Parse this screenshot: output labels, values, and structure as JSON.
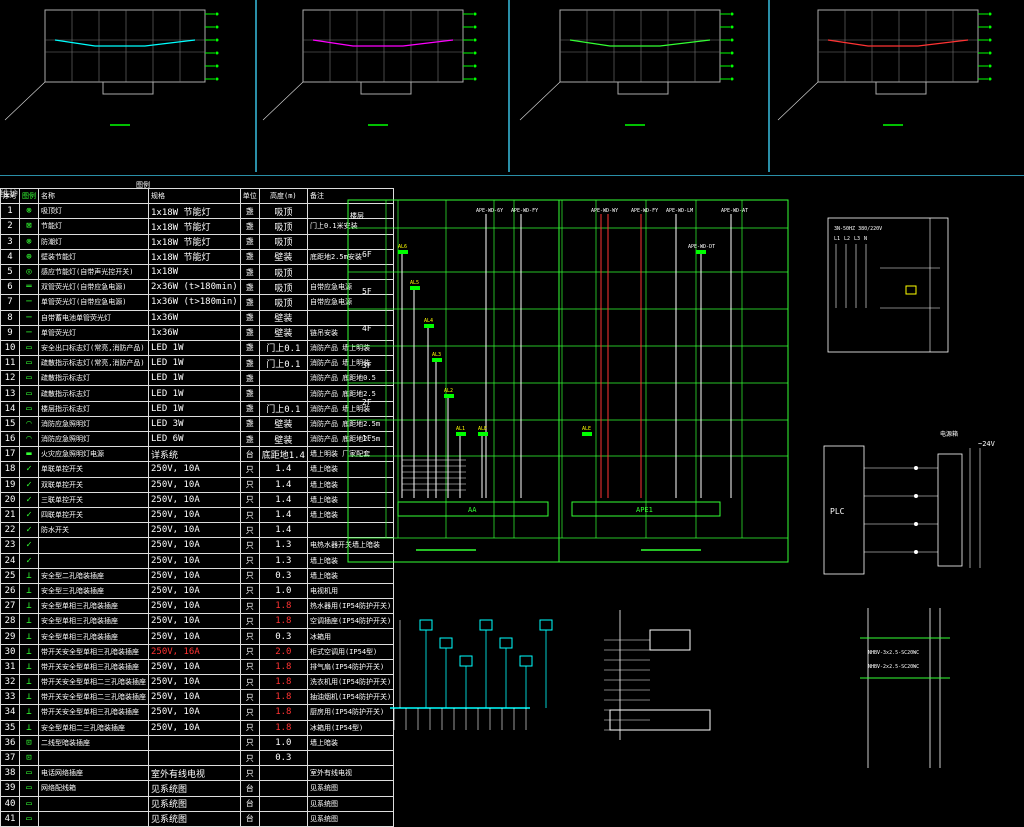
{
  "sheet_titles": [
    "",
    "",
    "",
    ""
  ],
  "table": {
    "header_title": "图例",
    "header_left": "维护",
    "columns": [
      "序号",
      "图例",
      "名称",
      "规格",
      "单位",
      "高度(m)",
      "备注"
    ],
    "rows": [
      {
        "no": "1",
        "icon": "⊗",
        "name": "吸顶灯",
        "spec": "1x18W  节能灯",
        "unit": "盏",
        "height": "吸顶",
        "remark": ""
      },
      {
        "no": "2",
        "icon": "⊠",
        "name": "节能灯",
        "spec": "1x18W  节能灯",
        "unit": "盏",
        "height": "吸顶",
        "remark": "门上0.1米安装"
      },
      {
        "no": "3",
        "icon": "⊗",
        "name": "防潮灯",
        "spec": "1x18W  节能灯",
        "unit": "盏",
        "height": "吸顶",
        "remark": ""
      },
      {
        "no": "4",
        "icon": "⊕",
        "name": "壁装节能灯",
        "spec": "1x18W  节能灯",
        "unit": "盏",
        "height": "壁装",
        "remark": "底距地2.5m安装"
      },
      {
        "no": "5",
        "icon": "◎",
        "name": "感应节能灯(自带声光控开关)",
        "spec": "1x18W",
        "unit": "盏",
        "height": "吸顶",
        "remark": ""
      },
      {
        "no": "6",
        "icon": "═",
        "name": "双管荧光灯(自带应急电源)",
        "spec": "2x36W (t>180min)",
        "unit": "盏",
        "height": "吸顶",
        "remark": "自带应急电源"
      },
      {
        "no": "7",
        "icon": "─",
        "name": "单管荧光灯(自带应急电源)",
        "spec": "1x36W (t>180min)",
        "unit": "盏",
        "height": "吸顶",
        "remark": "自带应急电源"
      },
      {
        "no": "8",
        "icon": "─",
        "name": "自带蓄电池单管荧光灯",
        "spec": "1x36W",
        "unit": "盏",
        "height": "壁装",
        "remark": ""
      },
      {
        "no": "9",
        "icon": "─",
        "name": "单管荧光灯",
        "spec": "1x36W",
        "unit": "盏",
        "height": "壁装",
        "remark": "链吊安装"
      },
      {
        "no": "10",
        "icon": "▭",
        "name": "安全出口标志灯(常亮,消防产品)",
        "spec": "LED 1W",
        "unit": "盏",
        "height": "门上0.1",
        "remark": "消防产品 墙上明装"
      },
      {
        "no": "11",
        "icon": "▭",
        "name": "疏散指示标志灯(常亮,消防产品)",
        "spec": "LED 1W",
        "unit": "盏",
        "height": "门上0.1",
        "remark": "消防产品 墙上明装"
      },
      {
        "no": "12",
        "icon": "▭",
        "name": "疏散指示标志灯",
        "spec": "LED 1W",
        "unit": "盏",
        "height": "",
        "remark": "消防产品 底距地0.5"
      },
      {
        "no": "13",
        "icon": "▭",
        "name": "疏散指示标志灯",
        "spec": "LED 1W",
        "unit": "盏",
        "height": "",
        "remark": "消防产品 底距地2.5"
      },
      {
        "no": "14",
        "icon": "▭",
        "name": "楼层指示标志灯",
        "spec": "LED 1W",
        "unit": "盏",
        "height": "门上0.1",
        "remark": "消防产品 墙上明装"
      },
      {
        "no": "15",
        "icon": "◠",
        "name": "消防应急照明灯",
        "spec": "LED 3W",
        "unit": "盏",
        "height": "壁装",
        "remark": "消防产品 底距地2.5m"
      },
      {
        "no": "16",
        "icon": "◠",
        "name": "消防应急照明灯",
        "spec": "LED 6W",
        "unit": "盏",
        "height": "壁装",
        "remark": "消防产品 底距地2.5m"
      },
      {
        "no": "17",
        "icon": "▬",
        "name": "火灾应急照明灯电源",
        "spec": "详系统",
        "unit": "台",
        "height": "底距地1.4",
        "remark": "墙上明装 厂家配套"
      },
      {
        "no": "18",
        "icon": "✓",
        "name": "单联单控开关",
        "spec": "250V, 10A",
        "unit": "只",
        "height": "1.4",
        "remark": "墙上暗装"
      },
      {
        "no": "19",
        "icon": "✓",
        "name": "双联单控开关",
        "spec": "250V, 10A",
        "unit": "只",
        "height": "1.4",
        "remark": "墙上暗装"
      },
      {
        "no": "20",
        "icon": "✓",
        "name": "三联单控开关",
        "spec": "250V, 10A",
        "unit": "只",
        "height": "1.4",
        "remark": "墙上暗装"
      },
      {
        "no": "21",
        "icon": "✓",
        "name": "四联单控开关",
        "spec": "250V, 10A",
        "unit": "只",
        "height": "1.4",
        "remark": "墙上暗装"
      },
      {
        "no": "22",
        "icon": "✓",
        "name": "防水开关",
        "spec": "250V, 10A",
        "unit": "只",
        "height": "1.4",
        "remark": ""
      },
      {
        "no": "23",
        "icon": "✓",
        "name": "",
        "spec": "250V, 10A",
        "unit": "只",
        "height": "1.3",
        "remark": "电热水器开关墙上暗装"
      },
      {
        "no": "24",
        "icon": "✓",
        "name": "",
        "spec": "250V, 10A",
        "unit": "只",
        "height": "1.3",
        "remark": "墙上暗装"
      },
      {
        "no": "25",
        "icon": "⊥",
        "name": "安全型二孔暗装插座",
        "spec": "250V, 10A",
        "unit": "只",
        "height": "0.3",
        "remark": "墙上暗装"
      },
      {
        "no": "26",
        "icon": "⊥",
        "name": "安全型三孔暗装插座",
        "spec": "250V, 10A",
        "unit": "只",
        "height": "1.0",
        "remark": "电视机用"
      },
      {
        "no": "27",
        "icon": "⊥",
        "name": "安全型单相三孔暗装插座",
        "spec": "250V, 10A",
        "unit": "只",
        "height": "1.8",
        "remark": "热水器用(IP54防护开关)"
      },
      {
        "no": "28",
        "icon": "⊥",
        "name": "安全型单相三孔暗装插座",
        "spec": "250V, 10A",
        "unit": "只",
        "height": "1.8",
        "remark": "空调插座(IP54防护开关)"
      },
      {
        "no": "29",
        "icon": "⊥",
        "name": "安全型单相三孔暗装插座",
        "spec": "250V, 10A",
        "unit": "只",
        "height": "0.3",
        "remark": "冰箱用"
      },
      {
        "no": "30",
        "icon": "⊥",
        "name": "带开关安全型单相三孔暗装插座",
        "spec": "250V, 16A",
        "unit": "只",
        "height": "2.0",
        "remark": "柜式空调用(IP54型)"
      },
      {
        "no": "31",
        "icon": "⊥",
        "name": "带开关安全型单相三孔暗装插座",
        "spec": "250V, 10A",
        "unit": "只",
        "height": "1.8",
        "remark": "排气扇(IP54防护开关)"
      },
      {
        "no": "32",
        "icon": "⊥",
        "name": "带开关安全型单相二三孔暗装插座",
        "spec": "250V, 10A",
        "unit": "只",
        "height": "1.8",
        "remark": "洗衣机用(IP54防护开关)"
      },
      {
        "no": "33",
        "icon": "⊥",
        "name": "带开关安全型单相二三孔暗装插座",
        "spec": "250V, 10A",
        "unit": "只",
        "height": "1.8",
        "remark": "抽油烟机(IP54防护开关)"
      },
      {
        "no": "34",
        "icon": "⊥",
        "name": "带开关安全型单相三孔暗装插座",
        "spec": "250V, 10A",
        "unit": "只",
        "height": "1.8",
        "remark": "厨房用(IP54防护开关)"
      },
      {
        "no": "35",
        "icon": "⊥",
        "name": "安全型单相二三孔暗装插座",
        "spec": "250V, 10A",
        "unit": "只",
        "height": "1.8",
        "remark": "冰箱用(IP54型)"
      },
      {
        "no": "36",
        "icon": "⊡",
        "name": "二线型暗装插座",
        "spec": "",
        "unit": "只",
        "height": "1.0",
        "remark": "墙上暗装"
      },
      {
        "no": "37",
        "icon": "⊡",
        "name": "",
        "spec": "",
        "unit": "只",
        "height": "0.3",
        "remark": ""
      },
      {
        "no": "38",
        "icon": "▭",
        "name": "电话网络插座",
        "spec": "室外有线电视",
        "unit": "只",
        "height": "",
        "remark": "室外有线电视"
      },
      {
        "no": "39",
        "icon": "▭",
        "name": "网络配线箱",
        "spec": "见系统图",
        "unit": "台",
        "height": "",
        "remark": "见系统图"
      },
      {
        "no": "40",
        "icon": "▭",
        "name": "",
        "spec": "见系统图",
        "unit": "台",
        "height": "",
        "remark": "见系统图"
      },
      {
        "no": "41",
        "icon": "▭",
        "name": "",
        "spec": "见系统图",
        "unit": "台",
        "height": "",
        "remark": "见系统图"
      }
    ],
    "red_rows": [
      27,
      28,
      30,
      31,
      32,
      33,
      34,
      35
    ]
  },
  "riser": {
    "header_left": "楼层",
    "floors": [
      "6F",
      "5F",
      "4F",
      "3F",
      "2F",
      "1F"
    ],
    "top_labels": [
      "APE-WD-6Y",
      "APE-WD-FY",
      "APE-WD-WY",
      "APE-WD-FY",
      "APE-WD-LM",
      "APE-WD-AT"
    ],
    "box_AA": "AA",
    "box_APE": "APE1",
    "panels_left": [
      "AL6",
      "AL5",
      "AL4",
      "AL3",
      "AL2",
      "AL1",
      "ALE"
    ],
    "panels_right": [
      "ALE",
      "APE-WD-DT"
    ]
  },
  "detail_labels": {
    "plc": "PLC",
    "power": "电源箱",
    "voltage": "~24V",
    "cable1": "NHBV-3x2.5-SC20WC",
    "cable2": "NHBV-2x2.5-SC20WC",
    "top_right_labels": [
      "3N-50HZ",
      "380/220V",
      "L1",
      "L2",
      "L3",
      "N"
    ]
  }
}
